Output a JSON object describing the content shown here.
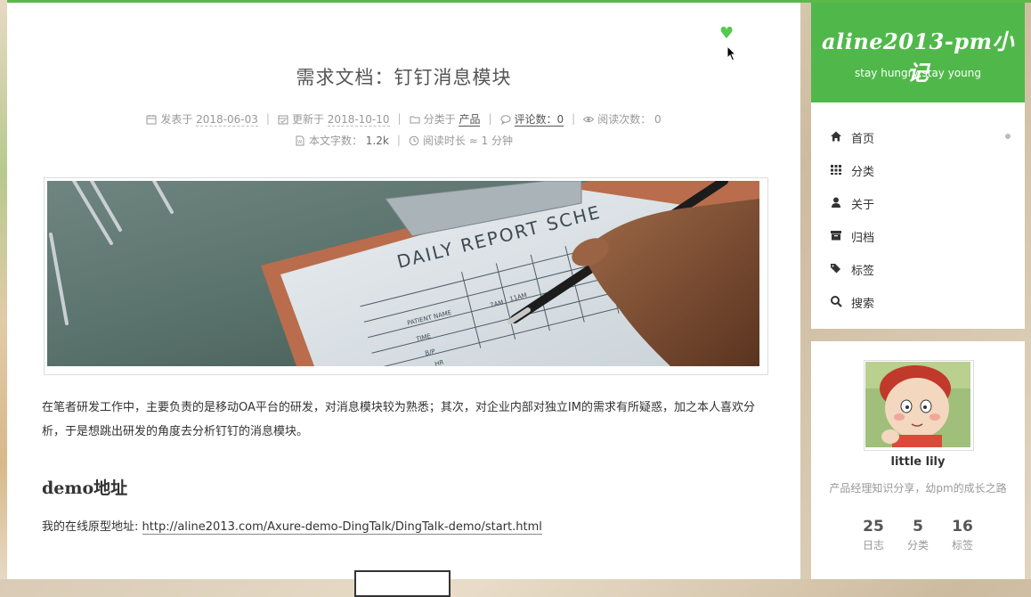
{
  "post": {
    "title": "需求文档：钉钉消息模块",
    "meta": {
      "published_label": "发表于",
      "published_date": "2018-06-03",
      "updated_label": "更新于",
      "updated_date": "2018-10-10",
      "category_label": "分类于",
      "category": "产品",
      "comments_label": "评论数：",
      "comments_count": "0",
      "reads_label": "阅读次数：",
      "reads_count": "0",
      "wordcount_label": "本文字数：",
      "wordcount": "1.2k",
      "readtime_label": "阅读时长 ≈",
      "readtime": "1 分钟"
    },
    "intro": "在笔者研发工作中，主要负责的是移动OA平台的研发，对消息模块较为熟悉；其次，对企业内部对独立IM的需求有所疑惑，加之本人喜欢分析，于是想跳出研发的角度去分析钉钉的消息模块。",
    "section_heading": "demo地址",
    "demo_prefix": "我的在线原型地址: ",
    "demo_link": "http://aline2013.com/Axure-demo-DingTalk/DingTalk-demo/start.html"
  },
  "hero_image": {
    "caption_text": "DAILY REPORT SCHE",
    "form_labels": [
      "PATIENT NAME",
      "TIME",
      "B/P",
      "HR",
      "7AM",
      "11AM"
    ]
  },
  "site": {
    "title": "aline2013-pm小记",
    "subtitle": "stay hungry,stay young"
  },
  "menu": [
    {
      "label": "首页",
      "icon": "home-icon"
    },
    {
      "label": "分类",
      "icon": "grid-icon"
    },
    {
      "label": "关于",
      "icon": "user-icon"
    },
    {
      "label": "归档",
      "icon": "archive-icon"
    },
    {
      "label": "标签",
      "icon": "tags-icon"
    },
    {
      "label": "搜索",
      "icon": "search-icon"
    }
  ],
  "profile": {
    "name": "little lily",
    "description": "产品经理知识分享，幼pm的成长之路",
    "stats": [
      {
        "count": "25",
        "label": "日志"
      },
      {
        "count": "5",
        "label": "分类"
      },
      {
        "count": "16",
        "label": "标签"
      }
    ]
  },
  "colors": {
    "accent": "#50b84a",
    "heart": "#55c94f"
  }
}
